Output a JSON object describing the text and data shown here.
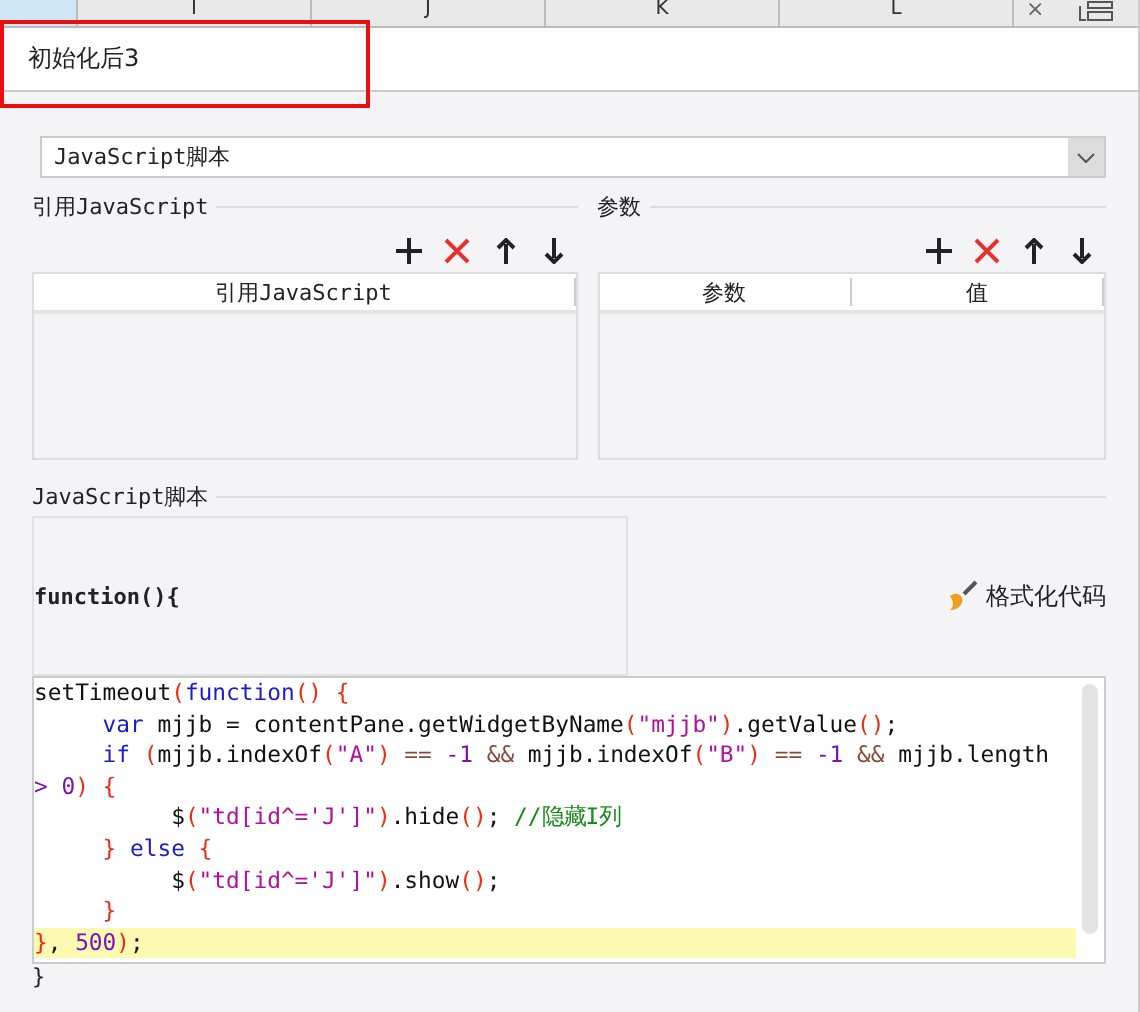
{
  "sheet_header": {
    "columns": [
      "I",
      "J",
      "K",
      "L"
    ],
    "close_glyph": "×"
  },
  "title_tab": {
    "label": "初始化后3",
    "annotated": true
  },
  "script_type": {
    "value": "JavaScript脚本"
  },
  "imports": {
    "legend": "引用JavaScript",
    "columns": [
      "引用JavaScript"
    ]
  },
  "params": {
    "legend": "参数",
    "columns": [
      "参数",
      "值"
    ]
  },
  "script": {
    "legend": "JavaScript脚本",
    "header": "function(){",
    "format_button": "格式化代码",
    "footer": "}",
    "lines": [
      {
        "highlighted": false,
        "tokens": [
          {
            "kind": "plain",
            "text": "setTimeout"
          },
          {
            "kind": "bracket",
            "text": "("
          },
          {
            "kind": "keyword",
            "text": "function"
          },
          {
            "kind": "bracket",
            "text": "() {"
          }
        ]
      },
      {
        "highlighted": false,
        "tokens": [
          {
            "kind": "keyword",
            "text": "     var"
          },
          {
            "kind": "plain",
            "text": " mjjb = contentPane.getWidgetByName"
          },
          {
            "kind": "bracket",
            "text": "("
          },
          {
            "kind": "string",
            "text": "\"mjjb\""
          },
          {
            "kind": "bracket",
            "text": ")"
          },
          {
            "kind": "plain",
            "text": ".getValue"
          },
          {
            "kind": "bracket",
            "text": "()"
          },
          {
            "kind": "plain",
            "text": ";"
          }
        ]
      },
      {
        "highlighted": false,
        "tokens": [
          {
            "kind": "keyword",
            "text": "     if"
          },
          {
            "kind": "bracket",
            "text": " ("
          },
          {
            "kind": "plain",
            "text": "mjjb.indexOf"
          },
          {
            "kind": "bracket",
            "text": "("
          },
          {
            "kind": "string",
            "text": "\"A\""
          },
          {
            "kind": "bracket",
            "text": ")"
          },
          {
            "kind": "operator",
            "text": " == "
          },
          {
            "kind": "number",
            "text": "-1"
          },
          {
            "kind": "operator",
            "text": " && "
          },
          {
            "kind": "plain",
            "text": "mjjb.indexOf"
          },
          {
            "kind": "bracket",
            "text": "("
          },
          {
            "kind": "string",
            "text": "\"B\""
          },
          {
            "kind": "bracket",
            "text": ")"
          },
          {
            "kind": "operator",
            "text": " == "
          },
          {
            "kind": "number",
            "text": "-1"
          },
          {
            "kind": "operator",
            "text": " && "
          },
          {
            "kind": "plain",
            "text": "mjjb.length"
          }
        ]
      },
      {
        "highlighted": false,
        "tokens": [
          {
            "kind": "number",
            "text": "> 0"
          },
          {
            "kind": "bracket",
            "text": ") {"
          }
        ]
      },
      {
        "highlighted": false,
        "tokens": [
          {
            "kind": "plain",
            "text": "          $"
          },
          {
            "kind": "bracket",
            "text": "("
          },
          {
            "kind": "string",
            "text": "\"td[id^='J']\""
          },
          {
            "kind": "bracket",
            "text": ")"
          },
          {
            "kind": "plain",
            "text": ".hide"
          },
          {
            "kind": "bracket",
            "text": "()"
          },
          {
            "kind": "plain",
            "text": "; "
          },
          {
            "kind": "comment",
            "text": "//隐藏I列"
          }
        ]
      },
      {
        "highlighted": false,
        "tokens": [
          {
            "kind": "bracket",
            "text": "     }"
          },
          {
            "kind": "keyword",
            "text": " else"
          },
          {
            "kind": "bracket",
            "text": " {"
          }
        ]
      },
      {
        "highlighted": false,
        "tokens": [
          {
            "kind": "plain",
            "text": "          $"
          },
          {
            "kind": "bracket",
            "text": "("
          },
          {
            "kind": "string",
            "text": "\"td[id^='J']\""
          },
          {
            "kind": "bracket",
            "text": ")"
          },
          {
            "kind": "plain",
            "text": ".show"
          },
          {
            "kind": "bracket",
            "text": "()"
          },
          {
            "kind": "plain",
            "text": ";"
          }
        ]
      },
      {
        "highlighted": false,
        "tokens": [
          {
            "kind": "bracket",
            "text": "     }"
          }
        ]
      },
      {
        "highlighted": true,
        "tokens": [
          {
            "kind": "bracket",
            "text": "}"
          },
          {
            "kind": "plain",
            "text": ", "
          },
          {
            "kind": "number",
            "text": "500"
          },
          {
            "kind": "bracket",
            "text": ")"
          },
          {
            "kind": "plain",
            "text": ";"
          }
        ]
      }
    ]
  }
}
